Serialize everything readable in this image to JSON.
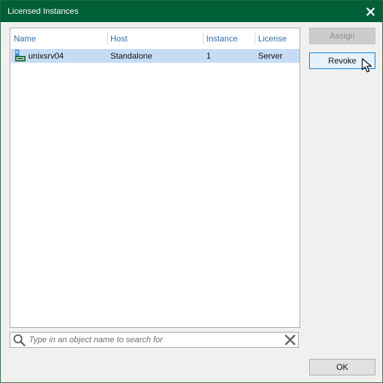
{
  "window": {
    "title": "Licensed Instances"
  },
  "table": {
    "columns": [
      "Name",
      "Host",
      "Instance",
      "License"
    ],
    "rows": [
      {
        "name": "unixsrv04",
        "host": "Standalone",
        "instance": "1",
        "license": "Server",
        "selected": true
      }
    ]
  },
  "search": {
    "placeholder": "Type in an object name to search for"
  },
  "buttons": {
    "assign": "Assign",
    "revoke": "Revoke",
    "ok": "OK"
  },
  "icons": {
    "title_close": "close-icon",
    "row": "server-icon",
    "search": "search-icon",
    "clear": "clear-x-icon"
  },
  "colors": {
    "titlebar": "#005f37",
    "header_text": "#2a6bb3",
    "selection": "#c6dcf5"
  }
}
